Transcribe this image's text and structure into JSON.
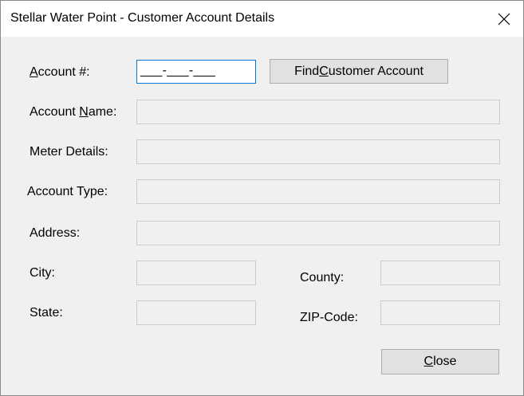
{
  "window": {
    "title": "Stellar Water Point - Customer Account Details"
  },
  "account": {
    "label_prefix": "A",
    "label_rest": "ccount #:",
    "mask_value": "___-___-___"
  },
  "find_button": {
    "prefix": "Find ",
    "mnemonic": "C",
    "rest": "ustomer Account"
  },
  "fields": {
    "account_name": {
      "prefix": "Account ",
      "mnemonic": "N",
      "rest": "ame:"
    },
    "meter_details": {
      "label": "Meter Details:"
    },
    "account_type": {
      "label": "Account Type:"
    },
    "address": {
      "label": "Address:"
    },
    "city": {
      "label": "City:"
    },
    "county": {
      "label": "County:"
    },
    "state": {
      "label": "State:"
    },
    "zip": {
      "label": "ZIP-Code:"
    }
  },
  "close_button": {
    "mnemonic": "C",
    "rest": "lose"
  }
}
